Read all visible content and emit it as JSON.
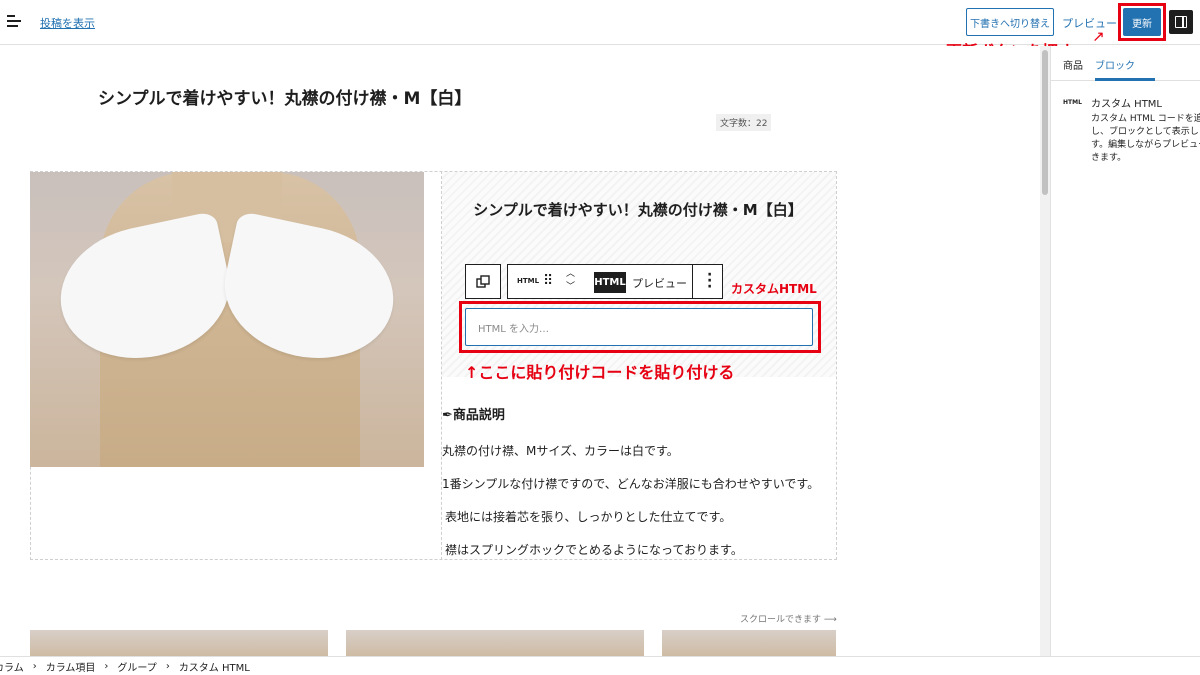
{
  "header": {
    "view_post": "投稿を表示",
    "switch_draft": "下書きへ切り替え",
    "preview": "プレビュー",
    "update": "更新"
  },
  "annotations": {
    "update_hint": "更新ボタンを押す",
    "custom_html": "カスタムHTML",
    "paste_hint": "↑ここに貼り付けコードを貼り付ける",
    "color": "#e60012"
  },
  "editor": {
    "post_title": "シンプルで着けやすい！丸襟の付け襟・M【白】",
    "char_count": "文字数：22",
    "product_title": "シンプルで着けやすい！丸襟の付け襟・M【白】",
    "toolbar": {
      "html_small": "HTML",
      "html_button": "HTML",
      "preview": "プレビュー"
    },
    "html_placeholder": "HTML を入力…",
    "description_heading": "商品説明",
    "description_lines": [
      "丸襟の付け襟、Mサイズ、カラーは白です。",
      "1番シンプルな付け襟ですので、どんなお洋服にも合わせやすいです。",
      "表地には接着芯を張り、しっかりとした仕立てです。",
      "襟はスプリングホックでとめるようになっております。"
    ],
    "scroll_hint": "スクロールできます ⟶"
  },
  "sidebar": {
    "tabs": [
      "商品",
      "ブロック"
    ],
    "active_tab": "ブロック",
    "block_icon": "HTML",
    "block_title": "カスタム HTML",
    "block_desc": "カスタム HTML コードを追加し、ブロックとして表示します。編集しながらプレビューできます。"
  },
  "breadcrumb": [
    "カラム",
    "カラム項目",
    "グループ",
    "カスタム HTML"
  ],
  "colors": {
    "accent": "#2271b1",
    "dark": "#1e1e1e"
  }
}
